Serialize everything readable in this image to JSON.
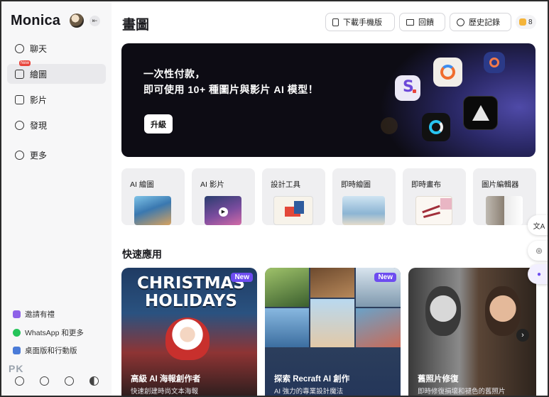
{
  "sidebar": {
    "brand": "Monica",
    "nav": [
      {
        "label": "聊天",
        "icon": "chat-icon"
      },
      {
        "label": "繪圖",
        "icon": "image-icon",
        "badge": "New"
      },
      {
        "label": "影片",
        "icon": "video-icon"
      },
      {
        "label": "發現",
        "icon": "compass-icon"
      },
      {
        "label": "更多",
        "icon": "plus-circle-icon"
      }
    ],
    "footer_links": [
      {
        "label": "邀請有禮",
        "icon": "gift-icon"
      },
      {
        "label": "WhatsApp 和更多",
        "icon": "whatsapp-icon"
      },
      {
        "label": "桌面版和行動版",
        "icon": "devices-icon"
      }
    ],
    "watermark": "PK"
  },
  "header": {
    "title": "畫圖",
    "buttons": [
      {
        "label": "下載手機版",
        "icon": "phone-icon"
      },
      {
        "label": "回饋",
        "icon": "mail-icon"
      },
      {
        "label": "歷史記錄",
        "icon": "clock-icon"
      }
    ],
    "credits": "8"
  },
  "banner": {
    "line1": "一次性付款，",
    "line2": "即可使用 10+ 種圖片與影片 AI 模型！",
    "cta": "升級"
  },
  "tools": [
    {
      "label": "AI 繪圖"
    },
    {
      "label": "AI 影片"
    },
    {
      "label": "設計工具"
    },
    {
      "label": "即時繪圖"
    },
    {
      "label": "即時畫布"
    },
    {
      "label": "圖片編輯器"
    }
  ],
  "quick_apps": {
    "title": "快速應用",
    "cards": [
      {
        "title": "高級 AI 海報創作者",
        "subtitle": "快速創建時尚文本海報",
        "badge": "New",
        "art_text": "CHRISTMAS HOLIDAYS"
      },
      {
        "title": "探索 Recraft AI 創作",
        "subtitle": "AI 強力的專業設計魔法",
        "badge": "New"
      },
      {
        "title": "舊照片修復",
        "subtitle": "即時修復損壞和褪色的舊照片"
      }
    ]
  },
  "colors": {
    "accent": "#6d4cf0",
    "sidebar_bg": "#f7f7f8",
    "banner_bg": "#0d0c14"
  }
}
